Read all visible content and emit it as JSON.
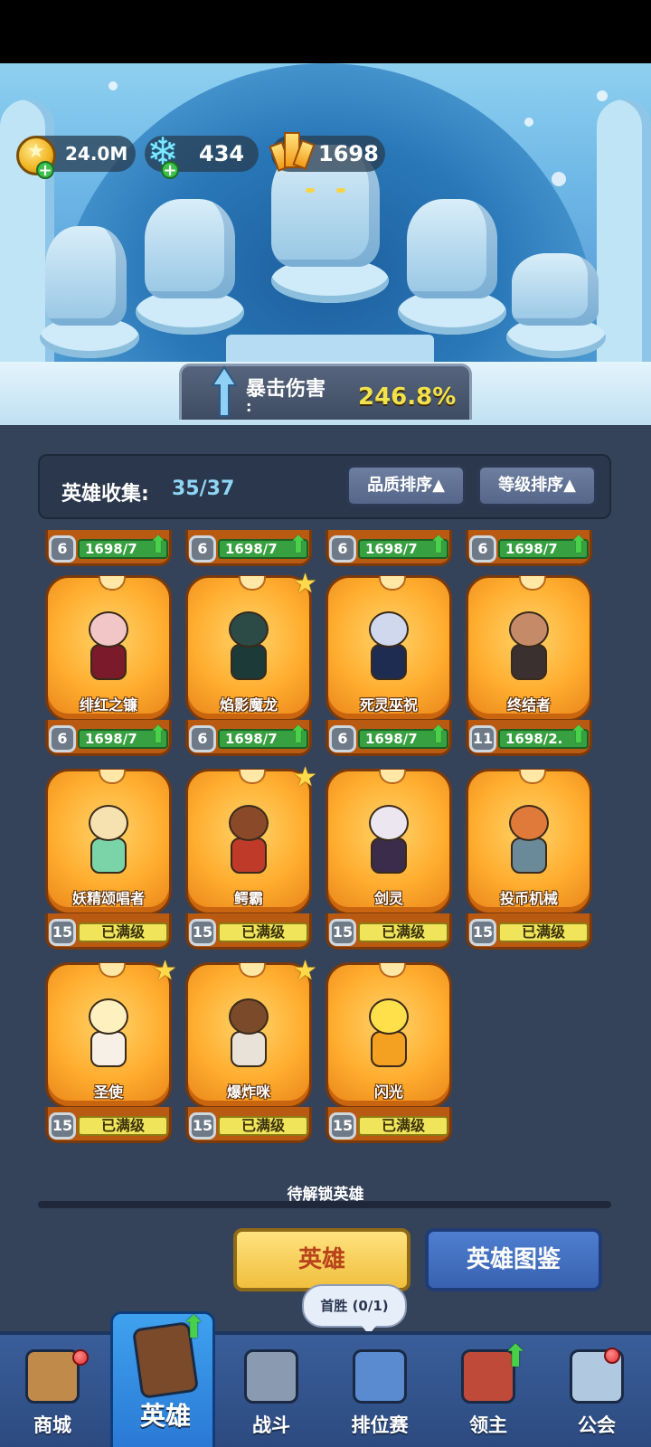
{
  "currency": {
    "gold": "24.0M",
    "gems": "434",
    "crystals": "1698"
  },
  "crit": {
    "label": "暴击伤害",
    "colon": ":",
    "value": "246.8%"
  },
  "collection": {
    "label": "英雄收集:",
    "count": "35/37",
    "sort_quality": "品质排序",
    "sort_level": "等级排序",
    "sort_arrow": "▲"
  },
  "partial_row": [
    {
      "level": "6",
      "progress": "1698/7"
    },
    {
      "level": "6",
      "progress": "1698/7"
    },
    {
      "level": "6",
      "progress": "1698/7"
    },
    {
      "level": "6",
      "progress": "1698/7"
    }
  ],
  "heroes": [
    {
      "name": "绯红之镰",
      "level": "6",
      "progress": "1698/7",
      "star": false,
      "maxed": false
    },
    {
      "name": "焰影魔龙",
      "level": "6",
      "progress": "1698/7",
      "star": true,
      "maxed": false
    },
    {
      "name": "死灵巫祝",
      "level": "6",
      "progress": "1698/7",
      "star": false,
      "maxed": false
    },
    {
      "name": "终结者",
      "level": "11",
      "progress": "1698/2.",
      "star": false,
      "maxed": false
    },
    {
      "name": "妖精颂唱者",
      "level": "15",
      "progress": "已满级",
      "star": false,
      "maxed": true
    },
    {
      "name": "鳄霸",
      "level": "15",
      "progress": "已满级",
      "star": true,
      "maxed": true
    },
    {
      "name": "剑灵",
      "level": "15",
      "progress": "已满级",
      "star": false,
      "maxed": true
    },
    {
      "name": "投币机械",
      "level": "15",
      "progress": "已满级",
      "star": false,
      "maxed": true
    },
    {
      "name": "圣使",
      "level": "15",
      "progress": "已满级",
      "star": true,
      "maxed": true
    },
    {
      "name": "爆炸咪",
      "level": "15",
      "progress": "已满级",
      "star": true,
      "maxed": true
    },
    {
      "name": "闪光",
      "level": "15",
      "progress": "已满级",
      "star": false,
      "maxed": true
    }
  ],
  "locked_label": "待解锁英雄",
  "tabs": {
    "hero": "英雄",
    "atlas": "英雄图鉴"
  },
  "bubble": "首胜 (0/1)",
  "nav": [
    {
      "label": "商城",
      "icon": "shop-chest-icon"
    },
    {
      "label": "英雄",
      "icon": "hero-card-icon"
    },
    {
      "label": "战斗",
      "icon": "crossed-swords-icon"
    },
    {
      "label": "排位赛",
      "icon": "rank-shield-icon"
    },
    {
      "label": "领主",
      "icon": "lord-banner-icon"
    },
    {
      "label": "公会",
      "icon": "guild-castle-icon"
    }
  ],
  "colors": {
    "accent_gold": "#f3e24a",
    "card_orange": "#ffad2e",
    "nav_blue": "#3a5e9a",
    "panel_dark": "#34425a"
  }
}
